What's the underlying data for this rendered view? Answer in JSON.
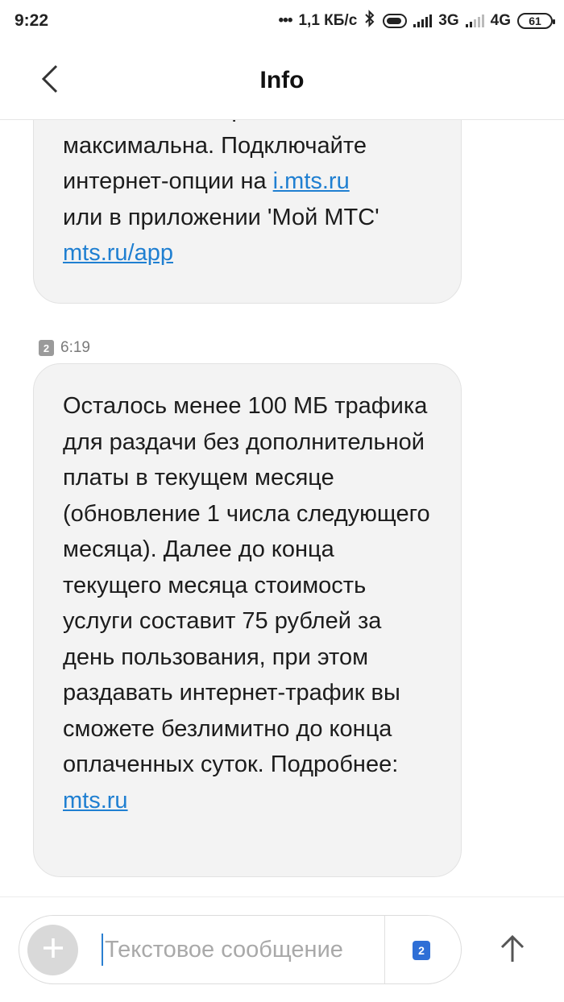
{
  "status_bar": {
    "time": "9:22",
    "network_speed": "1,1 КБ/с",
    "network_type_1": "3G",
    "network_type_2": "4G",
    "battery_level": "61"
  },
  "header": {
    "title": "Info"
  },
  "messages": [
    {
      "lines": [
        "отключена. Скорость",
        "максимальна. Подключайте"
      ],
      "line3_prefix": "интернет-опции на ",
      "line3_link": "i.mts.ru",
      "line4": "или в приложении 'Мой МТС'",
      "link2": "mts.ru/app"
    },
    {
      "sim": "2",
      "time": "6:19",
      "body": "Осталось менее 100 МБ трафика для раздачи без дополнительной платы в текущем месяце (обновление 1 числа следующего месяца). Далее до конца текущего месяца стоимость услуги составит 75 рублей за день пользования, при этом раздавать интернет-трафик вы сможете безлимитно до конца оплаченных суток. Подробнее:",
      "link": "mts.ru"
    }
  ],
  "composer": {
    "placeholder": "Текстовое сообщение",
    "sim": "2"
  },
  "icons": {
    "back": "chevron-left-icon",
    "add": "plus-icon",
    "send": "arrow-up-icon",
    "bluetooth": "bluetooth-icon"
  }
}
